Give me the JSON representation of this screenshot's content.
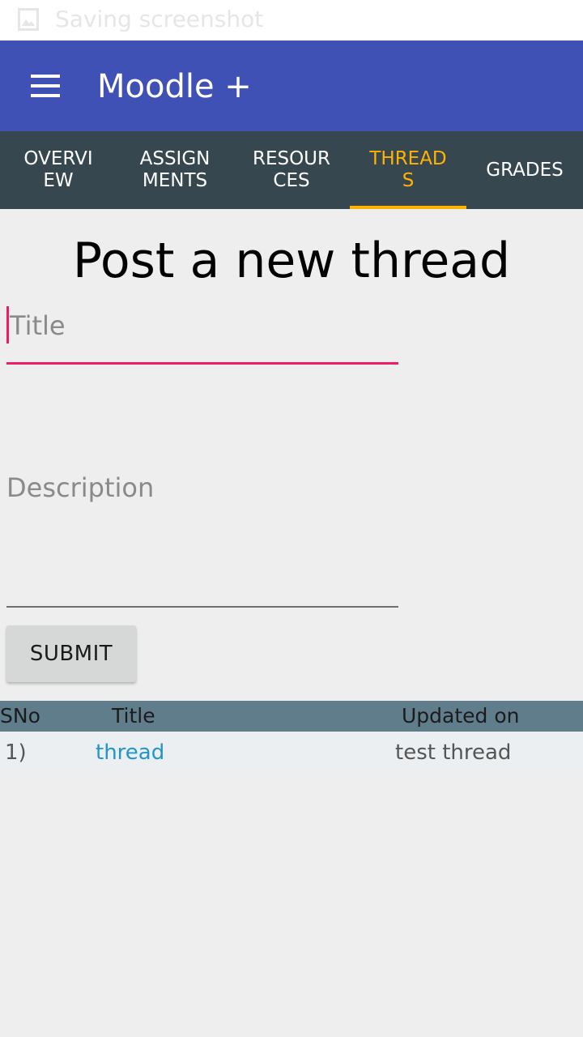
{
  "status_bar": {
    "notification_text": "Saving screenshot",
    "icon": "image-icon"
  },
  "app_bar": {
    "title": "Moodle +",
    "menu_icon": "menu-icon"
  },
  "tabs": [
    {
      "lines": [
        "OVERVI",
        "EW"
      ],
      "active": false
    },
    {
      "lines": [
        "ASSIGN",
        "MENTS"
      ],
      "active": false
    },
    {
      "lines": [
        "RESOUR",
        "CES"
      ],
      "active": false
    },
    {
      "lines": [
        "THREAD",
        "S"
      ],
      "active": true
    },
    {
      "lines": [
        "GRADES"
      ],
      "active": false
    }
  ],
  "form": {
    "heading": "Post a new thread",
    "title_placeholder": "Title",
    "description_placeholder": "Description",
    "submit_label": "SUBMIT"
  },
  "table": {
    "headers": [
      "SNo",
      "Title",
      "Updated on"
    ],
    "rows": [
      {
        "sno": "1)",
        "title": "thread",
        "updated": "test thread"
      }
    ]
  },
  "colors": {
    "app_bar": "#3f51b5",
    "tab_bar": "#37474f",
    "active_tab": "#ffb300",
    "focus_accent": "#e91e63",
    "table_header": "#607d8b",
    "link": "#2196c9"
  }
}
